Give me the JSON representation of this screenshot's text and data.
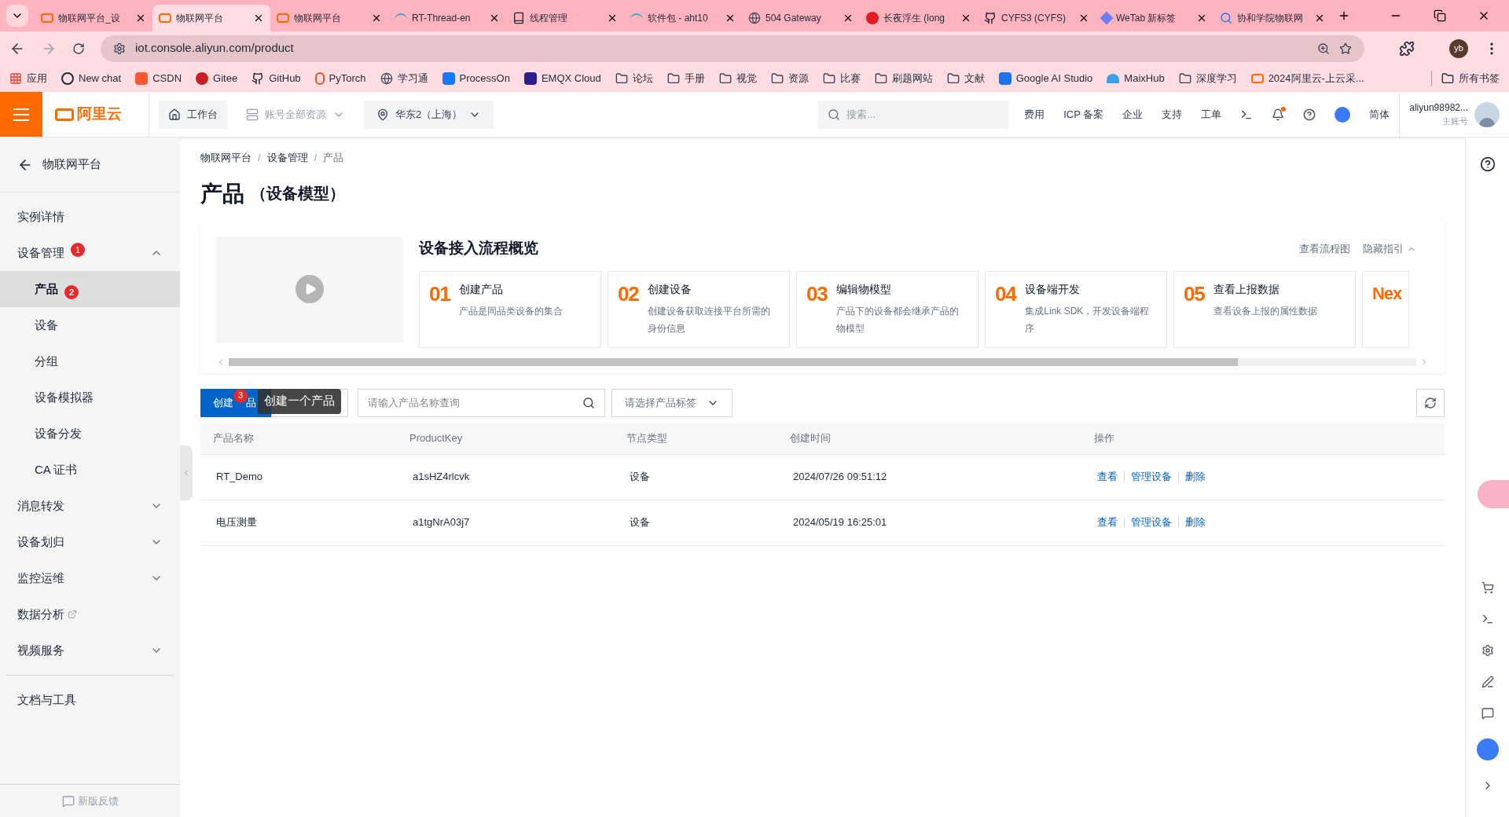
{
  "browser": {
    "tabs": [
      {
        "title": "物联网平台_设",
        "selected": false
      },
      {
        "title": "物联网平台",
        "selected": true
      },
      {
        "title": "物联网平台",
        "selected": false
      },
      {
        "title": "RT-Thread-en",
        "selected": false
      },
      {
        "title": "线程管理",
        "selected": false
      },
      {
        "title": "软件包 - aht10",
        "selected": false
      },
      {
        "title": "504 Gateway",
        "selected": false
      },
      {
        "title": "长夜浮生 (long",
        "selected": false
      },
      {
        "title": "CYFS3 (CYFS)",
        "selected": false
      },
      {
        "title": "WeTab 新标签",
        "selected": false
      },
      {
        "title": "协和学院物联网",
        "selected": false
      }
    ],
    "url": "iot.console.aliyun.com/product",
    "profile": "yb",
    "bookmarks": [
      "应用",
      "New chat",
      "CSDN",
      "Gitee",
      "GitHub",
      "PyTorch",
      "学习通",
      "ProcessOn",
      "EMQX Cloud",
      "论坛",
      "手册",
      "视觉",
      "资源",
      "比赛",
      "刷题网站",
      "文献",
      "Google AI Studio",
      "MaixHub",
      "深度学习",
      "2024阿里云-上云采..."
    ],
    "all_bookmarks": "所有书签"
  },
  "header": {
    "logo": "阿里云",
    "workbench": "工作台",
    "resources": {
      "label": "账号全部资源",
      "disabled": true
    },
    "region": "华东2（上海）",
    "search_placeholder": "搜索...",
    "nav": [
      "费用",
      "ICP 备案",
      "企业",
      "支持",
      "工单"
    ],
    "language": "简体",
    "user": "aliyun98982...",
    "role": "主账号"
  },
  "sidebar": {
    "back": "物联网平台",
    "items": [
      {
        "label": "实例详情",
        "kind": "link"
      },
      {
        "label": "设备管理",
        "kind": "group",
        "expanded": true,
        "badge": "1",
        "children": [
          {
            "label": "产品",
            "selected": true,
            "badge": "2"
          },
          {
            "label": "设备",
            "selected": false
          },
          {
            "label": "分组",
            "selected": false
          },
          {
            "label": "设备模拟器",
            "selected": false
          },
          {
            "label": "设备分发",
            "selected": false
          },
          {
            "label": "CA 证书",
            "selected": false
          }
        ]
      },
      {
        "label": "消息转发",
        "kind": "group",
        "expanded": false
      },
      {
        "label": "设备划归",
        "kind": "group",
        "expanded": false
      },
      {
        "label": "监控运维",
        "kind": "group",
        "expanded": false
      },
      {
        "label": "数据分析",
        "kind": "external"
      },
      {
        "label": "视频服务",
        "kind": "group",
        "expanded": false
      }
    ],
    "bottom_items": [
      "文档与工具"
    ],
    "feedback": "新版反馈"
  },
  "breadcrumb": {
    "items": [
      "物联网平台",
      "设备管理",
      "产品"
    ],
    "separator": "/"
  },
  "page_title": "产品",
  "page_subtitle": "（设备模型）",
  "guide": {
    "title": "设备接入流程概览",
    "links": [
      "查看流程图",
      "隐藏指引"
    ],
    "steps": [
      {
        "number": "01",
        "title": "创建产品",
        "desc": "产品是同品类设备的集合"
      },
      {
        "number": "02",
        "title": "创建设备",
        "desc": "创建设备获取连接平台所需的身份信息"
      },
      {
        "number": "03",
        "title": "编辑物模型",
        "desc": "产品下的设备都会继承产品的物模型"
      },
      {
        "number": "04",
        "title": "设备端开发",
        "desc": "集成Link SDK，开发设备端程序"
      },
      {
        "number": "05",
        "title": "查看上报数据",
        "desc": "查看设备上报的属性数据"
      }
    ],
    "next_partial": "Nex"
  },
  "toolbar": {
    "create_button": {
      "label_start": "创建",
      "label_end": "品"
    },
    "step_badge": "3",
    "tooltip": "创建一个产品",
    "search_placeholder": "请输入产品名称查询",
    "tag_placeholder": "请选择产品标签"
  },
  "table": {
    "columns": [
      "产品名称",
      "ProductKey",
      "节点类型",
      "创建时间",
      "操作"
    ],
    "rows": [
      {
        "name": "RT_Demo",
        "key": "a1sHZ4rlcvk",
        "node": "设备",
        "created": "2024/07/26 09:51:12",
        "actions": [
          "查看",
          "管理设备",
          "删除"
        ]
      },
      {
        "name": "电压测量",
        "key": "a1tgNrA03j7",
        "node": "设备",
        "created": "2024/05/19 16:25:01",
        "actions": [
          "查看",
          "管理设备",
          "删除"
        ]
      }
    ]
  }
}
